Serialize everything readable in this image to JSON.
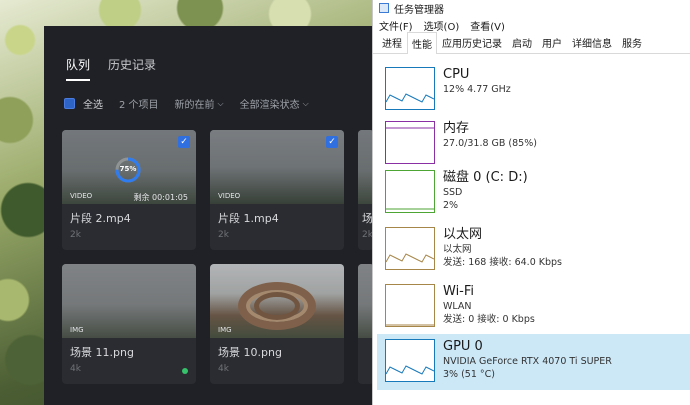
{
  "queue_window": {
    "tabs": [
      {
        "label": "队列",
        "active": true
      },
      {
        "label": "历史记录",
        "active": false
      }
    ],
    "toolbar": {
      "select_all": "全选",
      "count": "2 个项目",
      "sort": "新的在前",
      "filter": "全部渲染状态"
    },
    "cards": [
      {
        "name": "片段 2.mp4",
        "resolution": "2k",
        "type": "VIDEO",
        "remaining": "剩余 00:01:05",
        "progress_percent": 75,
        "progress_label": "75%",
        "checked": true
      },
      {
        "name": "片段 1.mp4",
        "resolution": "2k",
        "type": "VIDEO",
        "checked": true
      },
      {
        "name": "场景 11.png",
        "resolution": "4k",
        "type": "IMG",
        "done": true
      },
      {
        "name": "场景 10.png",
        "resolution": "4k",
        "type": "IMG"
      }
    ],
    "partial_card_name": "场",
    "partial_card_res": "2k"
  },
  "task_manager": {
    "title": "任务管理器",
    "menu": [
      "文件(F)",
      "选项(O)",
      "查看(V)"
    ],
    "tabs": [
      "进程",
      "性能",
      "应用历史记录",
      "启动",
      "用户",
      "详细信息",
      "服务"
    ],
    "active_tab": "性能",
    "items": [
      {
        "title": "CPU",
        "line1": "12% 4.77 GHz",
        "line2": "",
        "color": "#1779ba"
      },
      {
        "title": "内存",
        "line1": "27.0/31.8 GB (85%)",
        "line2": "",
        "color": "#8b2fa5"
      },
      {
        "title": "磁盘 0 (C: D:)",
        "line1": "SSD",
        "line2": "2%",
        "color": "#4da634"
      },
      {
        "title": "以太网",
        "line1": "以太网",
        "line2": "发送: 168 接收: 64.0 Kbps",
        "color": "#a7864a"
      },
      {
        "title": "Wi-Fi",
        "line1": "WLAN",
        "line2": "发送: 0 接收: 0 Kbps",
        "color": "#a7864a"
      },
      {
        "title": "GPU 0",
        "line1": "NVIDIA GeForce RTX 4070 Ti SUPER",
        "line2": "3% (51 °C)",
        "color": "#1779ba",
        "selected": true
      }
    ]
  }
}
